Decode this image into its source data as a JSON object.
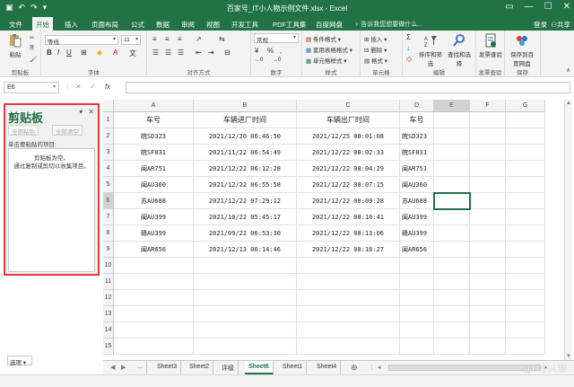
{
  "window": {
    "title": "百家号_IT小人物示例文件.xlsx - Excel",
    "controls": [
      "—",
      "☐",
      "✕"
    ]
  },
  "tabs": [
    "文件",
    "开始",
    "插入",
    "页面布局",
    "公式",
    "数据",
    "审阅",
    "视图",
    "开发工具",
    "PDF工具集",
    "百度网盘"
  ],
  "active_tab": "开始",
  "tell_me": "告诉我您想要做什么...",
  "login": "登录",
  "share": "共享",
  "ribbon": {
    "groups": {
      "clipboard": "剪贴板",
      "font": "字体",
      "align": "对齐方式",
      "number": "数字",
      "styles": "样式",
      "cells": "单元格",
      "edit": "编辑",
      "invoice": "发票查验",
      "save": "保存"
    },
    "paste": "粘贴",
    "font_name": "等线",
    "font_size": "11",
    "number_format": "常规",
    "cond_format": "条件格式",
    "table_format": "套用表格格式",
    "cell_styles": "单元格样式",
    "insert": "插入",
    "delete": "删除",
    "format": "格式",
    "sort_filter": "排序和筛选",
    "find_select": "查找和选择",
    "invoice_check": "发票查验",
    "save_baidu": "保存到百度网盘"
  },
  "formula_bar": {
    "name_box": "E6",
    "fx": "fx"
  },
  "clipboard_pane": {
    "title": "剪贴板",
    "paste_all": "全部粘贴",
    "clear_all": "全部清空",
    "hint": "单击要粘贴的项目:",
    "empty_text": "剪贴板为空。\n通过复制或剪切以收集项目。",
    "options": "选项"
  },
  "grid": {
    "columns": [
      "A",
      "B",
      "C",
      "D",
      "E",
      "F",
      "G"
    ],
    "rows": [
      "1",
      "2",
      "3",
      "4",
      "5",
      "6",
      "7",
      "8",
      "9",
      "10",
      "11",
      "12",
      "13",
      "14",
      "15"
    ],
    "selected_cell": "E6",
    "headers": [
      "车号",
      "车辆进厂时间",
      "车辆出厂时间",
      "车号"
    ],
    "data": [
      [
        "皖SD323",
        "2021/12/20 06:46:50",
        "2021/12/25 08:01:08",
        "皖SD323"
      ],
      [
        "皖SF831",
        "2021/11/22 06:54:49",
        "2021/12/22 08:02:33",
        "皖SF831"
      ],
      [
        "闽AR751",
        "2021/12/22 06:12:28",
        "2021/12/22 08:04:29",
        "闽AR751"
      ],
      [
        "闽AU360",
        "2021/12/22 06:55:58",
        "2021/12/22 08:07:15",
        "闽AU360"
      ],
      [
        "苏AU688",
        "2021/12/22 07:29:12",
        "2021/12/22 08:09:28",
        "苏AU688"
      ],
      [
        "闽AU399",
        "2021/10/22 05:45:17",
        "2021/12/22 08:10:41",
        "闽AU399"
      ],
      [
        "赣AU399",
        "2021/09/22 06:53:30",
        "2021/12/22 08:13:06",
        "赣AU399"
      ],
      [
        "闽AR656",
        "2021/12/13 06:14:46",
        "2021/12/22 08:18:27",
        "闽AR656"
      ]
    ]
  },
  "sheets": {
    "tabs": [
      "...",
      "Sheet3",
      "Sheet2",
      "评级",
      "Sheet6",
      "Sheet1",
      "Sheet4"
    ],
    "active": "Sheet6",
    "add": "⊕"
  },
  "watermark": "@IT小人物"
}
